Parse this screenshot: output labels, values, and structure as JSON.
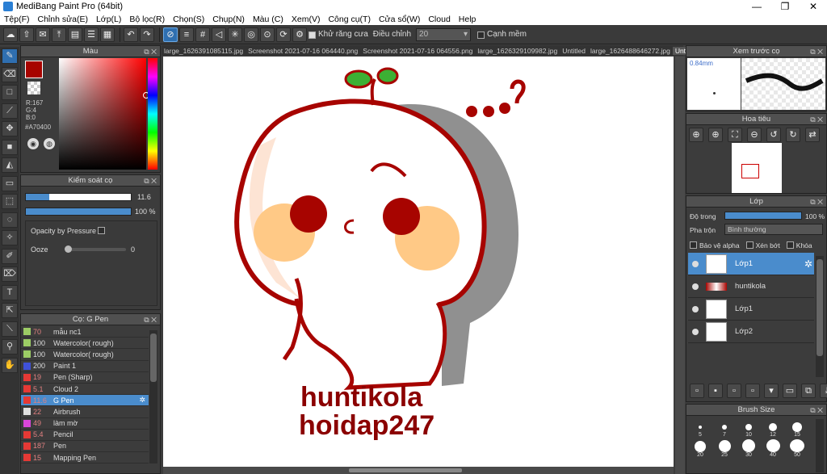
{
  "window": {
    "title": "MediBang Paint Pro (64bit)"
  },
  "menu": [
    "Tệp(F)",
    "Chỉnh sửa(E)",
    "Lớp(L)",
    "Bộ lọc(R)",
    "Chọn(S)",
    "Chụp(N)",
    "Màu (C)",
    "Xem(V)",
    "Công cụ(T)",
    "Cửa sổ(W)",
    "Cloud",
    "Help"
  ],
  "toolbar": {
    "antialias_label": "Khử răng cưa",
    "adjust_label": "Điều chỉnh",
    "adjust_value": "20",
    "snap_label": "Cạnh mềm"
  },
  "color_panel": {
    "title": "Màu",
    "r": "R:167",
    "g": "G:4",
    "b": "B:0",
    "hex": "#A70400",
    "fg_color": "#A70400",
    "bg_color": "#FFFFFF"
  },
  "brush_control": {
    "title": "Kiểm soát cọ",
    "size_value": "11.6",
    "opacity_value": "100 %",
    "opacity_pressure_label": "Opacity by Pressure",
    "ooze_label": "Ooze",
    "ooze_value": "0"
  },
  "brush_panel": {
    "title": "Cọ: G Pen",
    "items": [
      {
        "size": "70",
        "name": "mẫu nc1",
        "color": "#9ccc65"
      },
      {
        "size": "100",
        "name": "Watercolor( rough)",
        "color": "#9ccc65"
      },
      {
        "size": "100",
        "name": "Watercolor( rough)",
        "color": "#9ccc65"
      },
      {
        "size": "200",
        "name": "Paint 1",
        "color": "#3f51d8"
      },
      {
        "size": "19",
        "name": "Pen (Sharp)",
        "color": "#e53935"
      },
      {
        "size": "5.1",
        "name": "Cloud 2",
        "color": "#e53935"
      },
      {
        "size": "11.6",
        "name": "G Pen",
        "color": "#e53935"
      },
      {
        "size": "22",
        "name": "Airbrush",
        "color": "#e0e0e0"
      },
      {
        "size": "49",
        "name": "làm mờ",
        "color": "#d946d9"
      },
      {
        "size": "5.4",
        "name": "Pencil",
        "color": "#e53935"
      },
      {
        "size": "187",
        "name": "Pen",
        "color": "#e53935"
      },
      {
        "size": "15",
        "name": "Mapping Pen",
        "color": "#e53935"
      }
    ]
  },
  "tabs": [
    "large_1626391085115.jpg",
    "Screenshot 2021-07-16 064440.png",
    "Screenshot 2021-07-16 064556.png",
    "large_1626329109982.jpg",
    "Untitled",
    "large_1626488646272.jpg",
    "Untitled"
  ],
  "canvas": {
    "dots_text": "...?",
    "line1": "huntikola",
    "line2": "hoidap247"
  },
  "preview_panel": {
    "title": "Xem trước cọ",
    "size_label": "0.84mm"
  },
  "navigator_panel": {
    "title": "Hoa tiêu"
  },
  "layer_panel": {
    "title": "Lớp",
    "opacity_label": "Độ trong",
    "opacity_value": "100 %",
    "blend_label": "Pha trộn",
    "blend_value": "Bình thường",
    "protect_alpha": "Bảo vệ alpha",
    "clipping": "Xén bớt",
    "lock": "Khóa",
    "layers": [
      {
        "name": "Lớp1",
        "active": true
      },
      {
        "name": "huntikola",
        "active": false
      },
      {
        "name": "Lớp1",
        "active": false
      },
      {
        "name": "Lớp2",
        "active": false
      }
    ]
  },
  "brush_size_panel": {
    "title": "Brush Size",
    "sizes": [
      "5",
      "7",
      "10",
      "12",
      "15",
      "20",
      "25",
      "30",
      "40",
      "50"
    ]
  }
}
